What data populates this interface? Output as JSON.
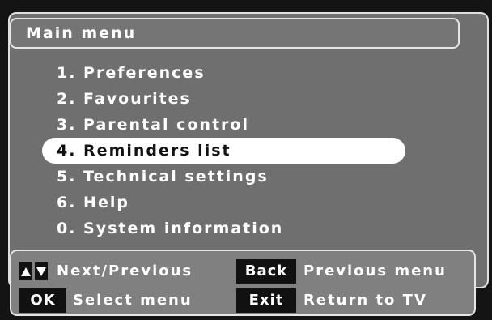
{
  "header": {
    "title": "Main menu"
  },
  "menu": {
    "items": [
      {
        "label": "1. Preferences"
      },
      {
        "label": "2. Favourites"
      },
      {
        "label": "3. Parental control"
      },
      {
        "label": "4. Reminders list",
        "selected": true
      },
      {
        "label": "5. Technical settings"
      },
      {
        "label": "6. Help"
      },
      {
        "label": "0. System information"
      }
    ]
  },
  "footer": {
    "nav_hint": "Next/Previous",
    "back_key": "Back",
    "back_hint": "Previous menu",
    "ok_key": "OK",
    "ok_hint": "Select menu",
    "exit_key": "Exit",
    "exit_hint": "Return to TV",
    "arrow_icons": [
      "arrow-up-icon",
      "arrow-down-icon"
    ]
  },
  "colors": {
    "background": "#141414",
    "panel": "#6f6f6f",
    "selected_bg": "#ffffff",
    "key_bg": "#111111",
    "text": "#ffffff"
  }
}
